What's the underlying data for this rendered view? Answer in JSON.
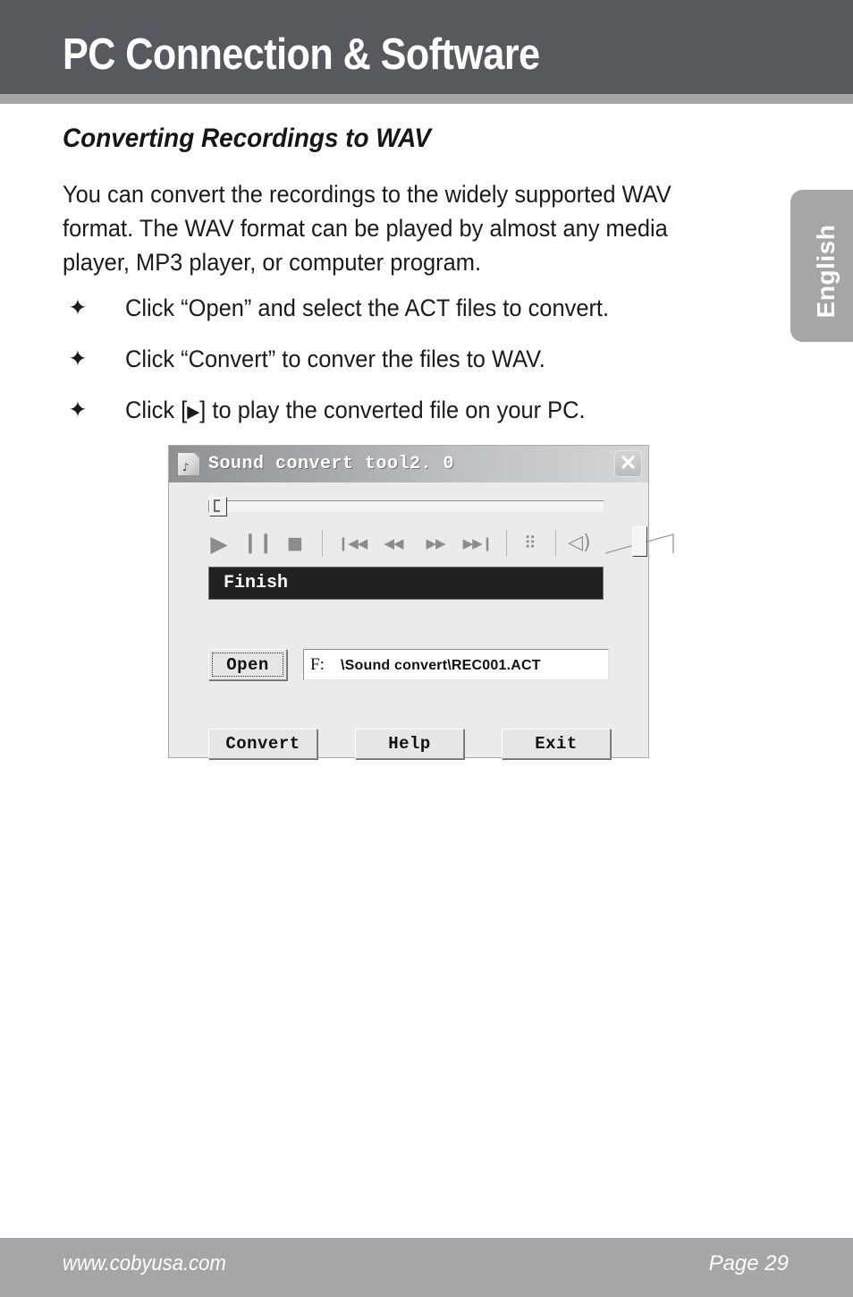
{
  "header": {
    "title": "PC Connection & Software",
    "bar_color": "#565a5e",
    "underbar_color": "#a6a6a8"
  },
  "language_tab": {
    "label": "English",
    "color": "#a6a6a8"
  },
  "section": {
    "heading": "Converting Recordings to WAV",
    "intro": "You can convert the recordings to the widely supported WAV format. The WAV format can be played by almost any media player, MP3 player, or computer program."
  },
  "bullets": [
    {
      "glyph": "✦",
      "text": "Click “Open” and select the ACT files to convert."
    },
    {
      "glyph": "✦",
      "text": "Click “Convert” to conver the files to WAV."
    },
    {
      "glyph": "✦",
      "pre": "Click [",
      "play": "▶",
      "post": "] to play the converted file on your PC."
    }
  ],
  "dialog": {
    "title": "Sound convert tool2. 0",
    "app_icon": "sound-document-icon",
    "close_label": "✕",
    "seek": {
      "value": 0,
      "thumb_position_pct": 0
    },
    "transport": [
      {
        "name": "play-button",
        "glyph": "▶"
      },
      {
        "name": "pause-button",
        "glyph": "❙❙"
      },
      {
        "name": "stop-button",
        "glyph": "■"
      },
      {
        "name": "previous-track-button",
        "glyph": "❙◀◀"
      },
      {
        "name": "rewind-button",
        "glyph": "◀◀"
      },
      {
        "name": "fast-forward-button",
        "glyph": "▶▶"
      },
      {
        "name": "next-track-button",
        "glyph": "▶▶❙"
      },
      {
        "name": "equalizer-button",
        "glyph": "⠿"
      },
      {
        "name": "mute-button",
        "glyph": "◁)"
      }
    ],
    "volume": {
      "value": 45
    },
    "status": "Finish",
    "open_button": "Open",
    "path_drive": "F:",
    "path_value": "\\Sound convert\\REC001.ACT",
    "buttons": {
      "convert": "Convert",
      "help": "Help",
      "exit": "Exit"
    },
    "status_bg": "#212121",
    "body_bg": "#ebebeb"
  },
  "footer": {
    "url": "www.cobyusa.com",
    "page": "Page 29",
    "bar_color": "#a6a6a8"
  }
}
